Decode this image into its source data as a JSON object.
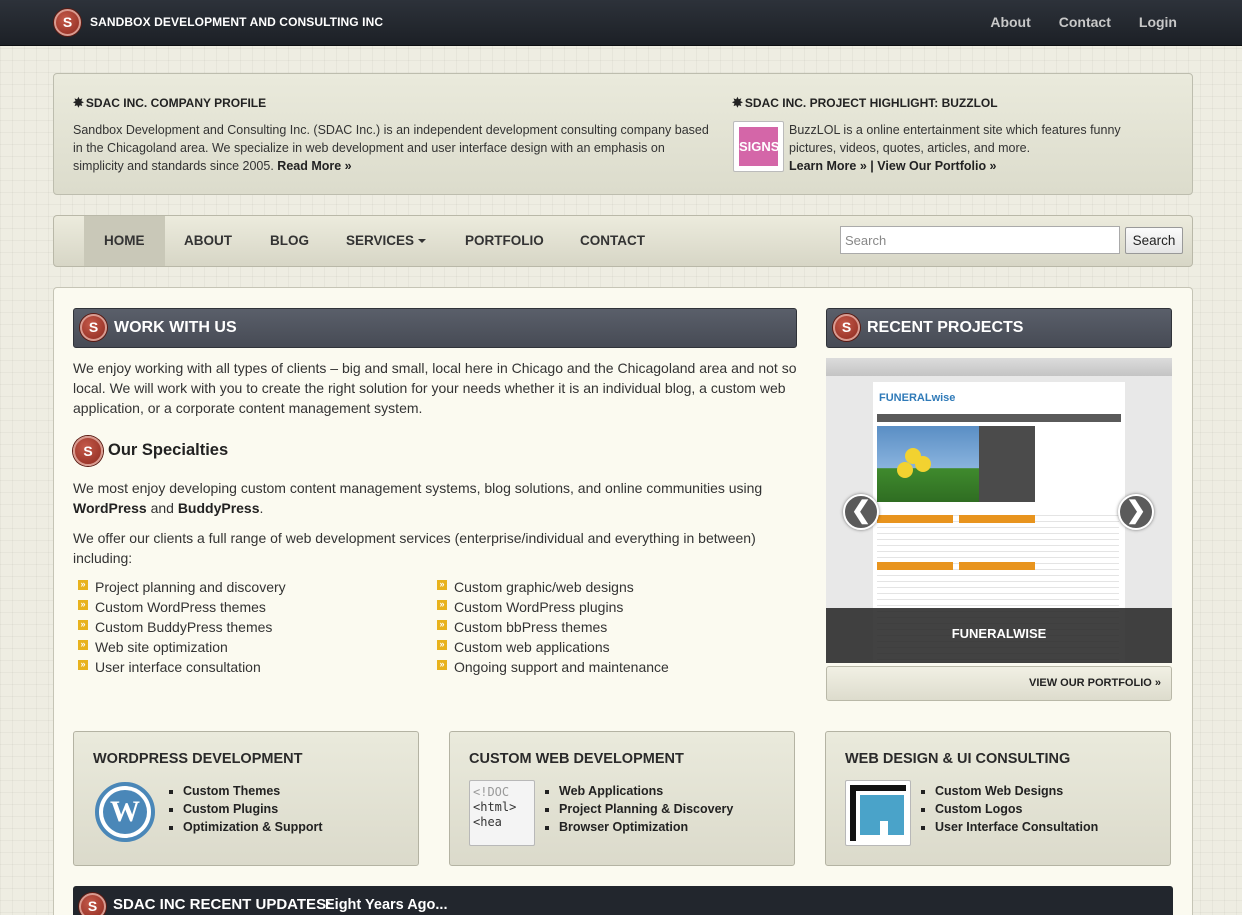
{
  "topbar": {
    "logo_letter": "S",
    "brand": "SANDBOX DEVELOPMENT AND CONSULTING INC",
    "nav": [
      "About",
      "Contact",
      "Login"
    ]
  },
  "profile": {
    "company": {
      "title": "SDAC INC. COMPANY PROFILE",
      "text": "Sandbox Development and Consulting Inc. (SDAC Inc.) is an independent development consulting company based in the Chicagoland area. We specialize in web development and user interface design with an emphasis on simplicity and standards since 2005.",
      "link": "Read More »"
    },
    "highlight": {
      "title": "SDAC INC. PROJECT HIGHLIGHT: BUZZLOL",
      "thumb_text": "SIGNS",
      "text": "BuzzLOL is a online entertainment site which features funny pictures, videos, quotes, articles, and more.",
      "link1": "Learn More »",
      "separator": "|",
      "link2": "View Our Portfolio »"
    }
  },
  "navbar": {
    "items": [
      "HOME",
      "ABOUT",
      "BLOG",
      "SERVICES",
      "PORTFOLIO",
      "CONTACT"
    ],
    "active": "HOME",
    "search_placeholder": "Search",
    "search_button": "Search"
  },
  "work": {
    "header": "WORK WITH US",
    "intro": "We enjoy working with all types of clients – big and small, local here in Chicago and the Chicagoland area and not so local. We will work with you to create the right solution for your needs whether it is an individual blog, a custom web application, or a corporate content management system.",
    "specialties_title": "Our Specialties",
    "spec_p1_a": "We most enjoy developing custom content management systems, blog solutions, and online communities using",
    "spec_p1_b": "WordPress",
    "spec_p1_c": "and",
    "spec_p1_d": "BuddyPress",
    "spec_p1_e": ".",
    "spec_p2": "We offer our clients a full range of web development services (enterprise/individual and everything in between) including:",
    "list_left": [
      "Project planning and discovery",
      "Custom WordPress themes",
      "Custom BuddyPress themes",
      "Web site optimization",
      "User interface consultation"
    ],
    "list_right": [
      "Custom graphic/web designs",
      "Custom WordPress plugins",
      "Custom bbPress themes",
      "Custom web applications",
      "Ongoing support and maintenance"
    ]
  },
  "projects": {
    "header": "RECENT PROJECTS",
    "site_logo_a": "FUNERAL",
    "site_logo_b": "wise",
    "caption": "FUNERALWISE",
    "prev": "❮",
    "next": "❯",
    "portfolio_link": "VIEW OUR PORTFOLIO »"
  },
  "services": [
    {
      "title": "WORDPRESS DEVELOPMENT",
      "icon": "wordpress-icon",
      "icon_letter": "W",
      "items": [
        "Custom Themes",
        "Custom Plugins",
        "Optimization & Support"
      ]
    },
    {
      "title": "CUSTOM WEB DEVELOPMENT",
      "icon": "html-code-icon",
      "icon_lines": [
        "<!DOC",
        "<html>",
        "<hea"
      ],
      "items": [
        "Web Applications",
        "Project Planning & Discovery",
        "Browser Optimization"
      ]
    },
    {
      "title": "WEB DESIGN & UI CONSULTING",
      "icon": "layout-icon",
      "items": [
        "Custom Web Designs",
        "Custom Logos",
        "User Interface Consultation"
      ]
    }
  ],
  "updates": {
    "title": "SDAC INC RECENT UPDATES:",
    "text": "Eight Years Ago..."
  },
  "colors": {
    "topbar": "#1c2026",
    "section_header": "#4f535d",
    "bullet": "#e8b21c",
    "accent_red": "#8e2a1f"
  }
}
